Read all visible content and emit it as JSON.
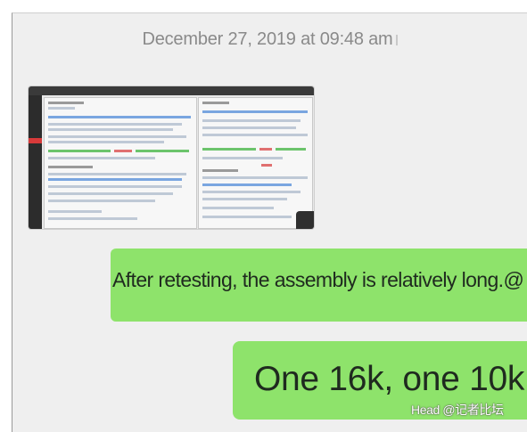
{
  "conversation": {
    "timestamp": "December 27, 2019 at 09:48 am",
    "messages": [
      {
        "text": "After retesting, the assembly is relatively long.@",
        "emoji": "smiling-with-sweat-emoji"
      },
      {
        "text": "One 16k, one 10k"
      }
    ],
    "attachment": {
      "type": "image",
      "icon": "screenshot-thumbnail"
    }
  },
  "watermark": "Head @记者比坛",
  "colors": {
    "chat_background": "#efefef",
    "bubble": "#8ee36b",
    "timestamp_text": "#8a8a8a"
  }
}
